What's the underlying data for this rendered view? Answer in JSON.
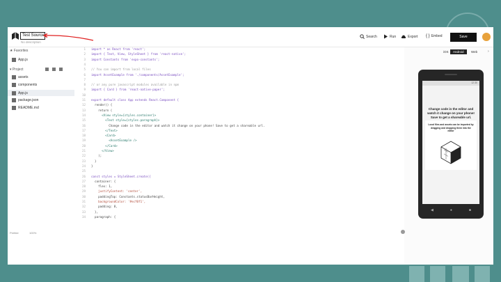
{
  "topbar": {
    "title_value": "Test Source",
    "subtitle": "No description",
    "search_label": "Search",
    "run_label": "Run",
    "export_label": "Export",
    "embed_label": "Embed",
    "save_label": "Save"
  },
  "sidebar": {
    "favorites_label": "Favorites",
    "favorite_items": [
      "App.js"
    ],
    "project_label": "Project",
    "files": [
      "assets",
      "components",
      "App.js",
      "package.json",
      "README.md"
    ],
    "active_file": "App.js",
    "bottom_left": "Prettier",
    "bottom_right": "100%"
  },
  "editor": {
    "lines": [
      {
        "n": "1",
        "t": "import * as React from 'react';",
        "c": "kw"
      },
      {
        "n": "2",
        "t": "import { Text, View, StyleSheet } from 'react-native';",
        "c": "kw"
      },
      {
        "n": "3",
        "t": "import Constants from 'expo-constants';",
        "c": "kw"
      },
      {
        "n": "4",
        "t": "",
        "c": ""
      },
      {
        "n": "5",
        "t": "// You can import from local files",
        "c": "cmt"
      },
      {
        "n": "6",
        "t": "import AssetExample from './components/AssetExample';",
        "c": "kw"
      },
      {
        "n": "7",
        "t": "",
        "c": ""
      },
      {
        "n": "8",
        "t": "// or any pure javascript modules available in npm",
        "c": "cmt"
      },
      {
        "n": "9",
        "t": "import { Card } from 'react-native-paper';",
        "c": "kw"
      },
      {
        "n": "10",
        "t": "",
        "c": ""
      },
      {
        "n": "11",
        "t": "export default class App extends React.Component {",
        "c": "kw"
      },
      {
        "n": "12",
        "t": "  render() {",
        "c": ""
      },
      {
        "n": "13",
        "t": "    return (",
        "c": ""
      },
      {
        "n": "14",
        "t": "      <View style={styles.container}>",
        "c": "jsx"
      },
      {
        "n": "15",
        "t": "        <Text style={styles.paragraph}>",
        "c": "jsx"
      },
      {
        "n": "16",
        "t": "          Change code in the editor and watch it change on your phone! Save to get a shareable url.",
        "c": ""
      },
      {
        "n": "17",
        "t": "        </Text>",
        "c": "jsx"
      },
      {
        "n": "18",
        "t": "        <Card>",
        "c": "jsx"
      },
      {
        "n": "19",
        "t": "          <AssetExample />",
        "c": "jsx"
      },
      {
        "n": "20",
        "t": "        </Card>",
        "c": "jsx"
      },
      {
        "n": "21",
        "t": "      </View>",
        "c": "jsx"
      },
      {
        "n": "22",
        "t": "    );",
        "c": ""
      },
      {
        "n": "23",
        "t": "  }",
        "c": ""
      },
      {
        "n": "24",
        "t": "}",
        "c": ""
      },
      {
        "n": "25",
        "t": "",
        "c": ""
      },
      {
        "n": "26",
        "t": "const styles = StyleSheet.create({",
        "c": "kw"
      },
      {
        "n": "27",
        "t": "  container: {",
        "c": ""
      },
      {
        "n": "28",
        "t": "    flex: 1,",
        "c": ""
      },
      {
        "n": "29",
        "t": "    justifyContent: 'center',",
        "c": "str"
      },
      {
        "n": "30",
        "t": "    paddingTop: Constants.statusBarHeight,",
        "c": ""
      },
      {
        "n": "31",
        "t": "    backgroundColor: '#ecf0f1',",
        "c": "str"
      },
      {
        "n": "32",
        "t": "    padding: 8,",
        "c": ""
      },
      {
        "n": "33",
        "t": "  },",
        "c": ""
      },
      {
        "n": "34",
        "t": "  paragraph: {",
        "c": ""
      }
    ]
  },
  "preview": {
    "tabs": [
      "iOS",
      "Android",
      "Web"
    ],
    "active_tab": "Android",
    "status_time": "12:30",
    "paragraph": "Change code in the editor and watch it change on your phone! Save to get a shareable url.",
    "card_text": "Local files and assets can be imported by dragging and dropping them into the editor"
  },
  "colors": {
    "background": "#4e8e8c",
    "save_button": "#111111",
    "arrow": "#e02020"
  }
}
